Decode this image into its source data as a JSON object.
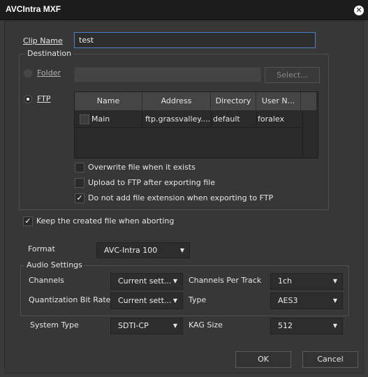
{
  "window": {
    "title": "AVCIntra MXF",
    "close_glyph": "✕"
  },
  "clip_name": {
    "label": "Clip Name",
    "value": "test"
  },
  "destination": {
    "title": "Destination",
    "folder": {
      "label": "Folder",
      "value": "",
      "selected": false
    },
    "select_button": "Select...",
    "ftp": {
      "label": "FTP",
      "selected": true
    },
    "ftp_table": {
      "columns": [
        "Name",
        "Address",
        "Directory",
        "User N..."
      ],
      "rows": [
        {
          "checked": false,
          "name": "Main",
          "address": "ftp.grassvalley....",
          "directory": "default",
          "user": "foralex"
        }
      ]
    },
    "options": [
      {
        "label": "Overwrite file when it exists",
        "checked": false
      },
      {
        "label": "Upload to FTP after exporting file",
        "checked": false
      },
      {
        "label": "Do not add file extension when exporting to FTP",
        "checked": true
      }
    ]
  },
  "keep_file": {
    "label": "Keep the created file when aborting",
    "checked": true
  },
  "format": {
    "label": "Format",
    "value": "AVC-Intra 100"
  },
  "audio": {
    "title": "Audio Settings",
    "channels": {
      "label": "Channels",
      "value": "Current sett..."
    },
    "channels_per_track": {
      "label": "Channels Per Track",
      "value": "1ch"
    },
    "quant_bit_rate": {
      "label": "Quantization Bit Rate",
      "value": "Current sett..."
    },
    "type": {
      "label": "Type",
      "value": "AES3"
    }
  },
  "system_type": {
    "label": "System Type",
    "value": "SDTI-CP"
  },
  "kag_size": {
    "label": "KAG Size",
    "value": "512"
  },
  "buttons": {
    "ok": "OK",
    "cancel": "Cancel"
  },
  "glyphs": {
    "check": "✓",
    "dropdown": "▼"
  },
  "colors": {
    "title_bar": "#1c1c1c",
    "dialog_bg": "#373737",
    "focus_border": "#4e82c9"
  },
  "icons": {
    "close": "close-icon",
    "check": "checkmark-icon",
    "dropdown": "chevron-down-icon"
  }
}
